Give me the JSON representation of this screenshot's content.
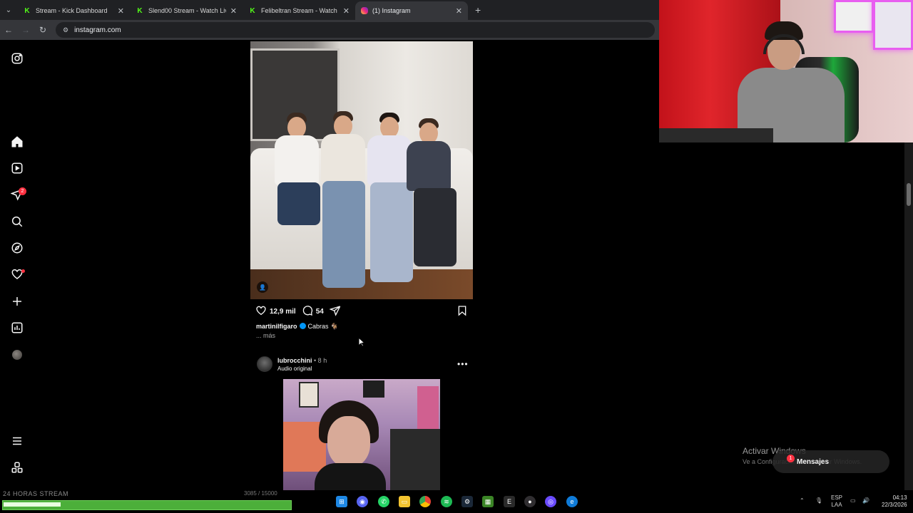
{
  "browser": {
    "tabs": [
      {
        "title": "Stream - Kick Dashboard",
        "icon": "kick-icon"
      },
      {
        "title": "Slend00 Stream - Watch Live o",
        "icon": "kick-icon"
      },
      {
        "title": "Felibeltran Stream - Watch Live",
        "icon": "kick-icon"
      },
      {
        "title": "(1) Instagram",
        "icon": "instagram-icon",
        "active": true
      }
    ],
    "url": "instagram.com"
  },
  "sidebar": {
    "notification_count": "2",
    "icons": [
      "instagram-logo-icon",
      "home-icon",
      "reels-icon",
      "direct-icon",
      "search-icon",
      "explore-icon",
      "heart-icon",
      "create-icon",
      "dashboard-icon",
      "profile-avatar",
      "menu-icon",
      "more-apps-icon"
    ]
  },
  "post1": {
    "likes": "12,9 mil",
    "comments": "54",
    "username": "martinilfigaro",
    "caption": "Cabras 🐐",
    "more_label": "... más"
  },
  "post2": {
    "username": "lubrocchini",
    "time": "• 8 h",
    "audio": "Audio original",
    "menu": "•••"
  },
  "overlay": {
    "activate_title": "Activar Windows",
    "activate_sub": "Ve a Configuración para activar Windows.",
    "messages_label": "Mensajes",
    "messages_count": "1"
  },
  "stream": {
    "label": "24 HORAS STREAM",
    "count": "3085 / 15000",
    "progress": 0.2
  },
  "taskbar": {
    "lang_top": "ESP",
    "lang_bottom": "LAA",
    "time": "04:13",
    "date": "22/3/2026"
  },
  "colors": {
    "background": "#000000",
    "accent": "#0095f6",
    "notification": "#ff3040",
    "kick_green": "#53fc18"
  }
}
